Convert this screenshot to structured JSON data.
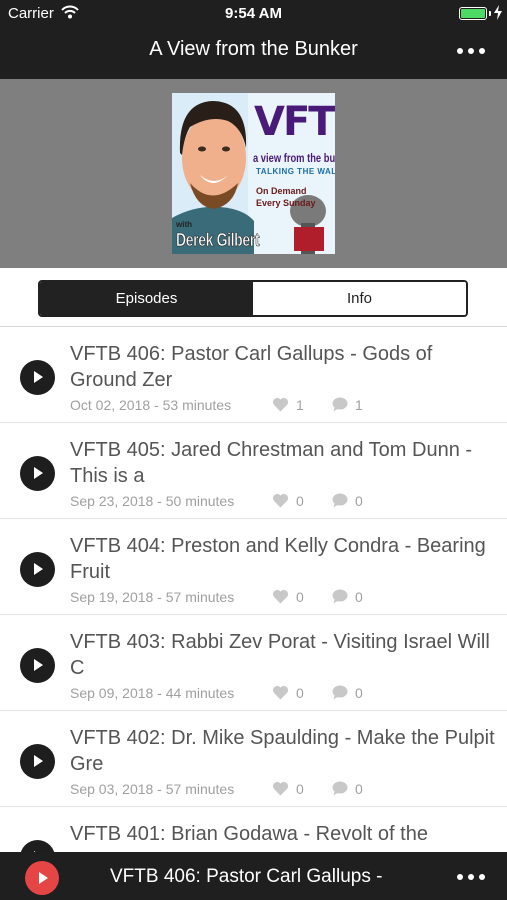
{
  "status_bar": {
    "carrier": "Carrier",
    "time": "9:54 AM",
    "battery_level": 1.0
  },
  "nav": {
    "title": "A View from the Bunker",
    "more_icon": "more-horizontal-icon"
  },
  "cover": {
    "logo": "VFTB",
    "subtitle": "a view from the bunker",
    "tagline": "TALKING THE WALK",
    "schedule_line1": "On Demand",
    "schedule_line2": "Every Sunday",
    "with": "with",
    "host": "Derek Gilbert"
  },
  "tabs": [
    {
      "label": "Episodes",
      "active": true
    },
    {
      "label": "Info",
      "active": false
    }
  ],
  "episodes": [
    {
      "title": "VFTB 406: Pastor Carl Gallups - Gods of Ground Zer",
      "meta": "Oct 02, 2018 - 53 minutes",
      "likes": "1",
      "comments": "1"
    },
    {
      "title": "VFTB 405: Jared Chrestman and Tom Dunn - This is a",
      "meta": "Sep 23, 2018 - 50 minutes",
      "likes": "0",
      "comments": "0"
    },
    {
      "title": "VFTB 404: Preston and Kelly Condra - Bearing Fruit",
      "meta": "Sep 19, 2018 - 57 minutes",
      "likes": "0",
      "comments": "0"
    },
    {
      "title": "VFTB 403: Rabbi Zev Porat - Visiting Israel Will C",
      "meta": "Sep 09, 2018 - 44 minutes",
      "likes": "0",
      "comments": "0"
    },
    {
      "title": "VFTB 402: Dr. Mike Spaulding - Make the Pulpit Gre",
      "meta": "Sep 03, 2018 - 57 minutes",
      "likes": "0",
      "comments": "0"
    },
    {
      "title": "VFTB 401: Brian Godawa - Revolt of the",
      "meta": "",
      "likes": "",
      "comments": ""
    }
  ],
  "player": {
    "now_playing": "VFTB 406: Pastor Carl Gallups -",
    "button_color": "#e64545",
    "more_icon": "more-horizontal-icon"
  },
  "colors": {
    "bar": "#1f1f1f",
    "hero_bg": "#7f7f7f",
    "battery": "#4cd964"
  }
}
